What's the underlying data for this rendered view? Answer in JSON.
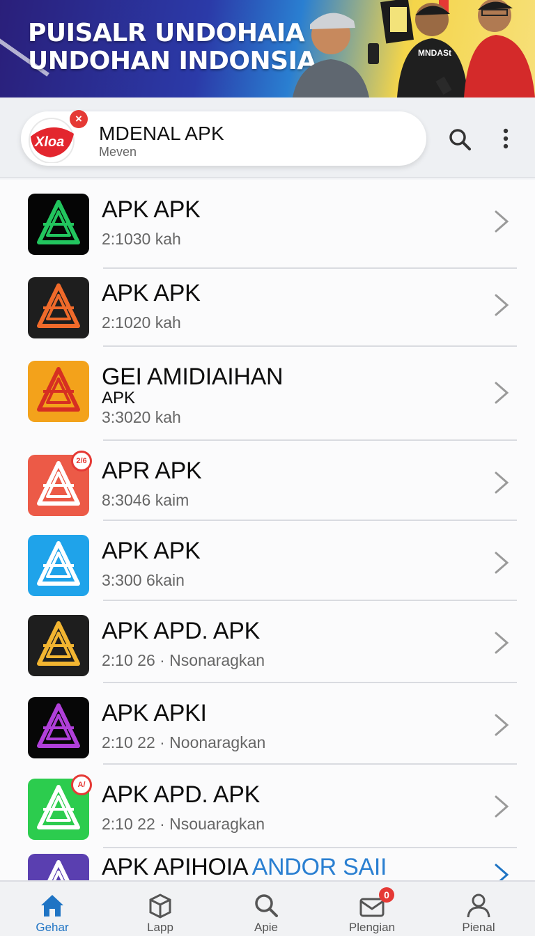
{
  "banner": {
    "title": "PUISALR UNDOHAIA\nUNDOHAN INDONSIA",
    "shirt_text": "MNDASt"
  },
  "header": {
    "logo_text": "Xloa",
    "title": "MDENAL APK",
    "subtitle": "Meven"
  },
  "apps": [
    {
      "title": "APK APK",
      "meta": "2:1030 kah",
      "icon": "triangle-logo-green",
      "color": "#22c55e",
      "bg": "#050505"
    },
    {
      "title": "APK APK",
      "meta": "2:1020 kah",
      "icon": "triangle-logo-orange",
      "color": "#f06a2a",
      "bg": "#1e1e1e"
    },
    {
      "title": "GEI AMIDIAIHAN",
      "title_line2": "APK",
      "meta": "3:3020 kah",
      "icon": "triangle-logo-red-on-yellow",
      "color": "#d62f22",
      "bg": "#f3a21b"
    },
    {
      "title": "APR APK",
      "meta": "8:3046 kaim",
      "icon": "triangle-logo-white-on-red",
      "color": "#ffffff",
      "bg": "#ec5a47",
      "badge": "2/6"
    },
    {
      "title": "APK APK",
      "meta": "3:300 6kain",
      "icon": "triangle-logo-white-on-blue",
      "color": "#ffffff",
      "bg": "#1fa3ea"
    },
    {
      "title": "APK APD. APK",
      "meta": "2:10 26 · Nsonaragkan",
      "icon": "triangle-logo-yellow",
      "color": "#f2b531",
      "bg": "#1e1e1e"
    },
    {
      "title": "APK APKI",
      "meta": "2:10 22 · Noonaragkan",
      "icon": "triangle-logo-purple",
      "color": "#b03fd9",
      "bg": "#070707"
    },
    {
      "title": "APK APD. APK",
      "meta": "2:10 22 · Nsouaragkan",
      "icon": "triangle-logo-white-on-green",
      "color": "#ffffff",
      "bg": "#2ccc4e",
      "badge": "A/"
    },
    {
      "title": "APK APIHOIA",
      "title_accent": "ANDOR SAII",
      "meta": "",
      "icon": "triangle-logo-white-on-purple",
      "color": "#ffffff",
      "bg": "#5a3fb0"
    }
  ],
  "bottom_nav": [
    {
      "label": "Gehar",
      "icon": "home-icon",
      "active": true
    },
    {
      "label": "Lapp",
      "icon": "box-icon",
      "active": false
    },
    {
      "label": "Apie",
      "icon": "search-icon",
      "active": false
    },
    {
      "label": "Plengian",
      "icon": "mail-icon",
      "active": false,
      "badge": "0"
    },
    {
      "label": "Pienal",
      "icon": "person-icon",
      "active": false
    }
  ],
  "colors": {
    "accent": "#1f74c4",
    "alert": "#e53935"
  }
}
